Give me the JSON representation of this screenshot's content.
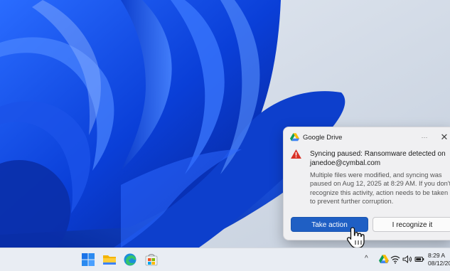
{
  "notification": {
    "app_name": "Google Drive",
    "title_line1": "Syncing paused: Ransomware detected on",
    "title_line2": "janedoe@cymbal.com",
    "body": "Multiple files were modified, and syncing was paused on Aug 12, 2025 at 8:29 AM. If you don't recognize this activity, action needs to be taken to prevent further corruption.",
    "more_label": "···",
    "close_label": "✕",
    "primary_button": "Take action",
    "secondary_button": "I recognize it",
    "icons": {
      "app": "google-drive-icon",
      "warning": "warning-triangle-icon"
    },
    "colors": {
      "warning": "#d93025",
      "primary": "#1f5fc4"
    }
  },
  "taskbar": {
    "pinned": [
      "start-icon",
      "file-explorer-icon",
      "edge-icon",
      "store-icon"
    ],
    "tray_chevron": "^",
    "tray_icons": [
      "google-drive-icon",
      "wifi-icon",
      "volume-icon",
      "battery-icon"
    ],
    "clock_time": "8:29 A",
    "clock_date": "08/12/20"
  }
}
